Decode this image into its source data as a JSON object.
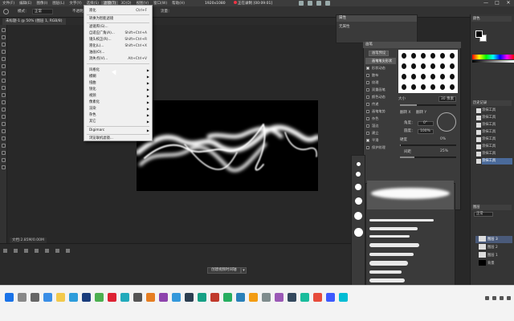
{
  "menubar": {
    "items": [
      "文件(F)",
      "编辑(E)",
      "图像(I)",
      "图层(L)",
      "文字(Y)",
      "选择(S)",
      "滤镜(T)",
      "3D(D)",
      "视图(V)",
      "窗口(W)",
      "帮助(H)"
    ],
    "active_index": 6
  },
  "recording": {
    "resolution": "1920x1080",
    "status": "正在录制 [00:09:01]"
  },
  "window_controls": [
    "—",
    "□",
    "✕"
  ],
  "options_bar": {
    "mode_label": "模式：",
    "mode_value": "正常",
    "opacity_label": "不透明度：",
    "flow_label": "流量："
  },
  "document_tab": "未标题-1 @ 50% (图层 1, RGB/8)",
  "dropdown": {
    "items": [
      {
        "label": "液化",
        "shortcut": "Ctrl+F",
        "submenu": false
      },
      {
        "label": "转换为智能滤镜",
        "shortcut": "",
        "submenu": false
      },
      {
        "label": "滤镜库(G)...",
        "shortcut": "",
        "submenu": false
      },
      {
        "label": "自适应广角(A)...",
        "shortcut": "Shift+Ctrl+A",
        "submenu": false
      },
      {
        "label": "镜头校正(R)...",
        "shortcut": "Shift+Ctrl+R",
        "submenu": false
      },
      {
        "label": "液化(L)...",
        "shortcut": "Shift+Ctrl+X",
        "submenu": false
      },
      {
        "label": "油画(O)...",
        "shortcut": "",
        "submenu": false
      },
      {
        "label": "消失点(V)...",
        "shortcut": "Alt+Ctrl+V",
        "submenu": false
      },
      {
        "label": "风格化",
        "shortcut": "",
        "submenu": true
      },
      {
        "label": "模糊",
        "shortcut": "",
        "submenu": true
      },
      {
        "label": "扭曲",
        "shortcut": "",
        "submenu": true
      },
      {
        "label": "锐化",
        "shortcut": "",
        "submenu": true
      },
      {
        "label": "视频",
        "shortcut": "",
        "submenu": true
      },
      {
        "label": "像素化",
        "shortcut": "",
        "submenu": true
      },
      {
        "label": "渲染",
        "shortcut": "",
        "submenu": true
      },
      {
        "label": "杂色",
        "shortcut": "",
        "submenu": true
      },
      {
        "label": "其它",
        "shortcut": "",
        "submenu": true
      },
      {
        "label": "Digimarc",
        "shortcut": "",
        "submenu": true
      },
      {
        "label": "浏览联机滤镜...",
        "shortcut": "",
        "submenu": false
      }
    ]
  },
  "status_bar": "文档:2.85M/0.00M",
  "timeline": {
    "create_button": "创建视频时间轴"
  },
  "panel_a": {
    "title": "属性",
    "body": "无属性"
  },
  "brush_settings": {
    "header": "画笔",
    "presets_button": "画笔预设",
    "options": [
      {
        "label": "画笔笔尖形状",
        "checked": false,
        "selected": true
      },
      {
        "label": "形状动态",
        "checked": true,
        "selected": false
      },
      {
        "label": "散布",
        "checked": false,
        "selected": false
      },
      {
        "label": "纹理",
        "checked": false,
        "selected": false
      },
      {
        "label": "双重画笔",
        "checked": false,
        "selected": false
      },
      {
        "label": "颜色动态",
        "checked": false,
        "selected": false
      },
      {
        "label": "传递",
        "checked": false,
        "selected": false
      },
      {
        "label": "画笔笔势",
        "checked": false,
        "selected": false
      },
      {
        "label": "杂色",
        "checked": false,
        "selected": false
      },
      {
        "label": "湿边",
        "checked": false,
        "selected": false
      },
      {
        "label": "建立",
        "checked": false,
        "selected": false
      },
      {
        "label": "平滑",
        "checked": true,
        "selected": false
      },
      {
        "label": "保护纹理",
        "checked": false,
        "selected": false
      }
    ],
    "size_label": "大小",
    "size_value": "30 像素",
    "flip_x": "翻转 X",
    "flip_y": "翻转 Y",
    "angle_label": "角度：",
    "angle_value": "0°",
    "roundness_label": "圆度：",
    "roundness_value": "100%",
    "hardness_label": "硬度",
    "hardness_value": "0%",
    "spacing_label": "间距",
    "spacing_value": "25%"
  },
  "right_dock": {
    "color_header": "颜色",
    "history_header": "历史记录",
    "history_items": [
      "涂抹工具",
      "涂抹工具",
      "涂抹工具",
      "涂抹工具",
      "涂抹工具",
      "涂抹工具",
      "涂抹工具",
      "涂抹工具"
    ],
    "layers_header": "图层",
    "blend_mode": "正常",
    "layers": [
      "图层 3",
      "图层 2",
      "图层 1",
      "背景"
    ]
  },
  "colors": {
    "menubar_bg": "#3c3c3c",
    "panel_bg": "#3b3b3b",
    "canvas": "#000000",
    "menu_bg": "#f0f0f0",
    "selection": "#4a6a9a",
    "taskbar_bg": "#f3f3f3"
  }
}
